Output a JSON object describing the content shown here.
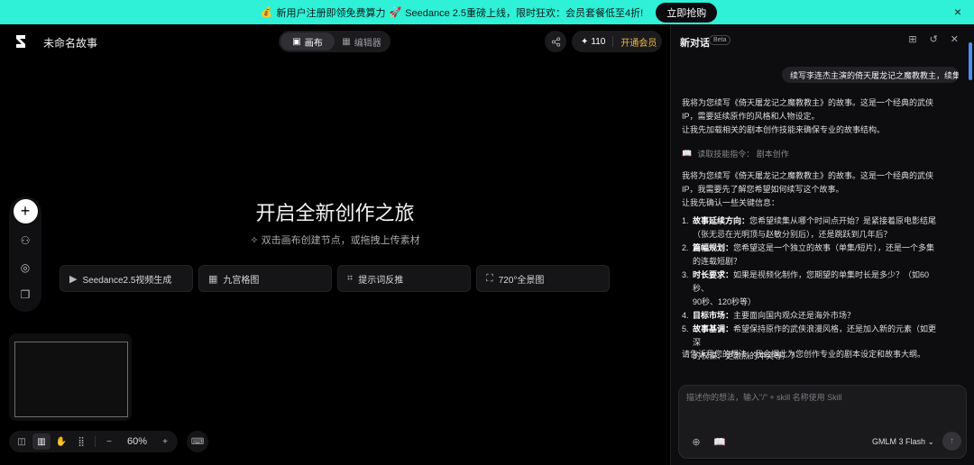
{
  "banner": {
    "emoji_left": "💰",
    "text_left": "新用户注册即领免费算力",
    "emoji_mid": "🚀",
    "text_right": "Seedance 2.5重磅上线，限时狂欢：会员套餐低至4折!",
    "cta": "立即抢购",
    "close_icon": "×"
  },
  "canvas": {
    "doc_title": "未命名故事",
    "mode_tabs": [
      {
        "label": "画布",
        "active": true
      },
      {
        "label": "编辑器",
        "active": false
      }
    ],
    "credits": "110",
    "vip_label": "开通会员",
    "hero_title": "开启全新创作之旅",
    "hero_sub": "双击画布创建节点，或拖拽上传素材",
    "quick_cards": [
      {
        "label": "Seedance2.5视频生成",
        "icon": "play-icon"
      },
      {
        "label": "九宫格图",
        "icon": "grid-icon"
      },
      {
        "label": "提示词反推",
        "icon": "scan-icon"
      },
      {
        "label": "720°全景图",
        "icon": "panorama-icon"
      }
    ],
    "zoom": "60%"
  },
  "panel": {
    "title": "新对话",
    "beta": "Beta",
    "user_message": "续写李连杰主演的倚天屠龙记之魔教教主，续集",
    "ai_para1": [
      "我将为您续写《倚天屠龙记之魔教教主》的故事。这是一个经典的武侠",
      "IP，需要延续原作的风格和人物设定。",
      "让我先加载相关的剧本创作技能来确保专业的故事结构。"
    ],
    "skill_line": "读取技能指令：  剧本创作",
    "ai_para2": [
      "我将为您续写《倚天屠龙记之魔教教主》的故事。这是一个经典的武侠",
      "IP，我需要先了解您希望如何续写这个故事。",
      "让我先确认一些关键信息："
    ],
    "questions": [
      {
        "num": "1.",
        "label": "故事延续方向：",
        "lines": [
          "您希望续集从哪个时间点开始？是紧接着原电影结尾",
          "（张无忌在光明顶与赵敏分别后），还是跳跃到几年后？"
        ]
      },
      {
        "num": "2.",
        "label": "篇幅规划：",
        "lines": [
          "您希望这是一个独立的故事（单集/短片），还是一个多集",
          "的连载短剧？"
        ]
      },
      {
        "num": "3.",
        "label": "时长要求：",
        "lines": [
          "如果是视频化制作，您期望的单集时长是多少？（如60秒、",
          "90秒、120秒等）"
        ]
      },
      {
        "num": "4.",
        "label": "目标市场：",
        "lines": [
          "主要面向国内观众还是海外市场？"
        ]
      },
      {
        "num": "5.",
        "label": "故事基调：",
        "lines": [
          "希望保持原作的武侠浪漫风格，还是加入新的元素（如更深",
          "的权谋、更激烈的冲突等）？"
        ]
      }
    ],
    "ai_para3": "请告诉我您的想法，我会据此为您创作专业的剧本设定和故事大纲。",
    "composer_placeholder": "描述你的想法，输入\"/\" + skill 名称使用 Skill",
    "model": "GMLM 3 Flash"
  },
  "colors": {
    "banner_bg": "#2ef1d7",
    "vip": "#f0b840",
    "scrollbar": "#4f8ef7"
  }
}
